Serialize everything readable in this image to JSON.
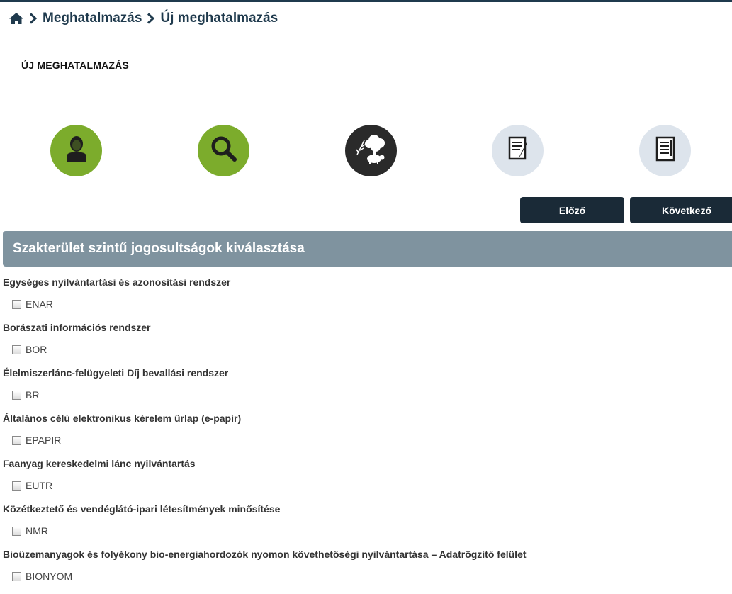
{
  "breadcrumb": {
    "home_icon": "home-icon",
    "items": [
      "Meghatalmazás",
      "Új meghatalmazás"
    ]
  },
  "page": {
    "title": "ÚJ MEGHATALMAZÁS"
  },
  "steps": [
    {
      "icon": "person-icon",
      "state": "completed",
      "color": "#7cac2c"
    },
    {
      "icon": "search-icon",
      "state": "completed",
      "color": "#7cac2c"
    },
    {
      "icon": "agriculture-icon",
      "state": "active",
      "color": "#2a2a2a"
    },
    {
      "icon": "document-edit-icon",
      "state": "pending",
      "color": "#dde4ec"
    },
    {
      "icon": "document-list-icon",
      "state": "pending",
      "color": "#dde4ec"
    }
  ],
  "nav": {
    "prev_label": "Előző",
    "next_label": "Következő"
  },
  "section": {
    "title": "Szakterület szintű jogosultságok kiválasztása"
  },
  "systems": [
    {
      "title": "Egységes nyilvántartási és azonosítási rendszer",
      "code": "ENAR",
      "checked": false
    },
    {
      "title": "Borászati információs rendszer",
      "code": "BOR",
      "checked": false
    },
    {
      "title": "Élelmiszerlánc-felügyeleti Díj bevallási rendszer",
      "code": "BR",
      "checked": false
    },
    {
      "title": "Általános célú elektronikus kérelem űrlap (e-papír)",
      "code": "EPAPIR",
      "checked": false
    },
    {
      "title": "Faanyag kereskedelmi lánc nyilvántartás",
      "code": "EUTR",
      "checked": false
    },
    {
      "title": "Közétkeztető és vendéglátó-ipari létesítmények minősítése",
      "code": "NMR",
      "checked": false
    },
    {
      "title": "Bioüzemanyagok és folyékony bio-energiahordozók nyomon követhetőségi nyilvántartása – Adatrögzítő felület",
      "code": "BIONYOM",
      "checked": false
    }
  ],
  "colors": {
    "accent": "#1f3a4d",
    "button": "#1a2a37",
    "section_header": "#7f939f",
    "step_done": "#7cac2c",
    "step_active": "#2a2a2a",
    "step_pending": "#dde4ec"
  }
}
